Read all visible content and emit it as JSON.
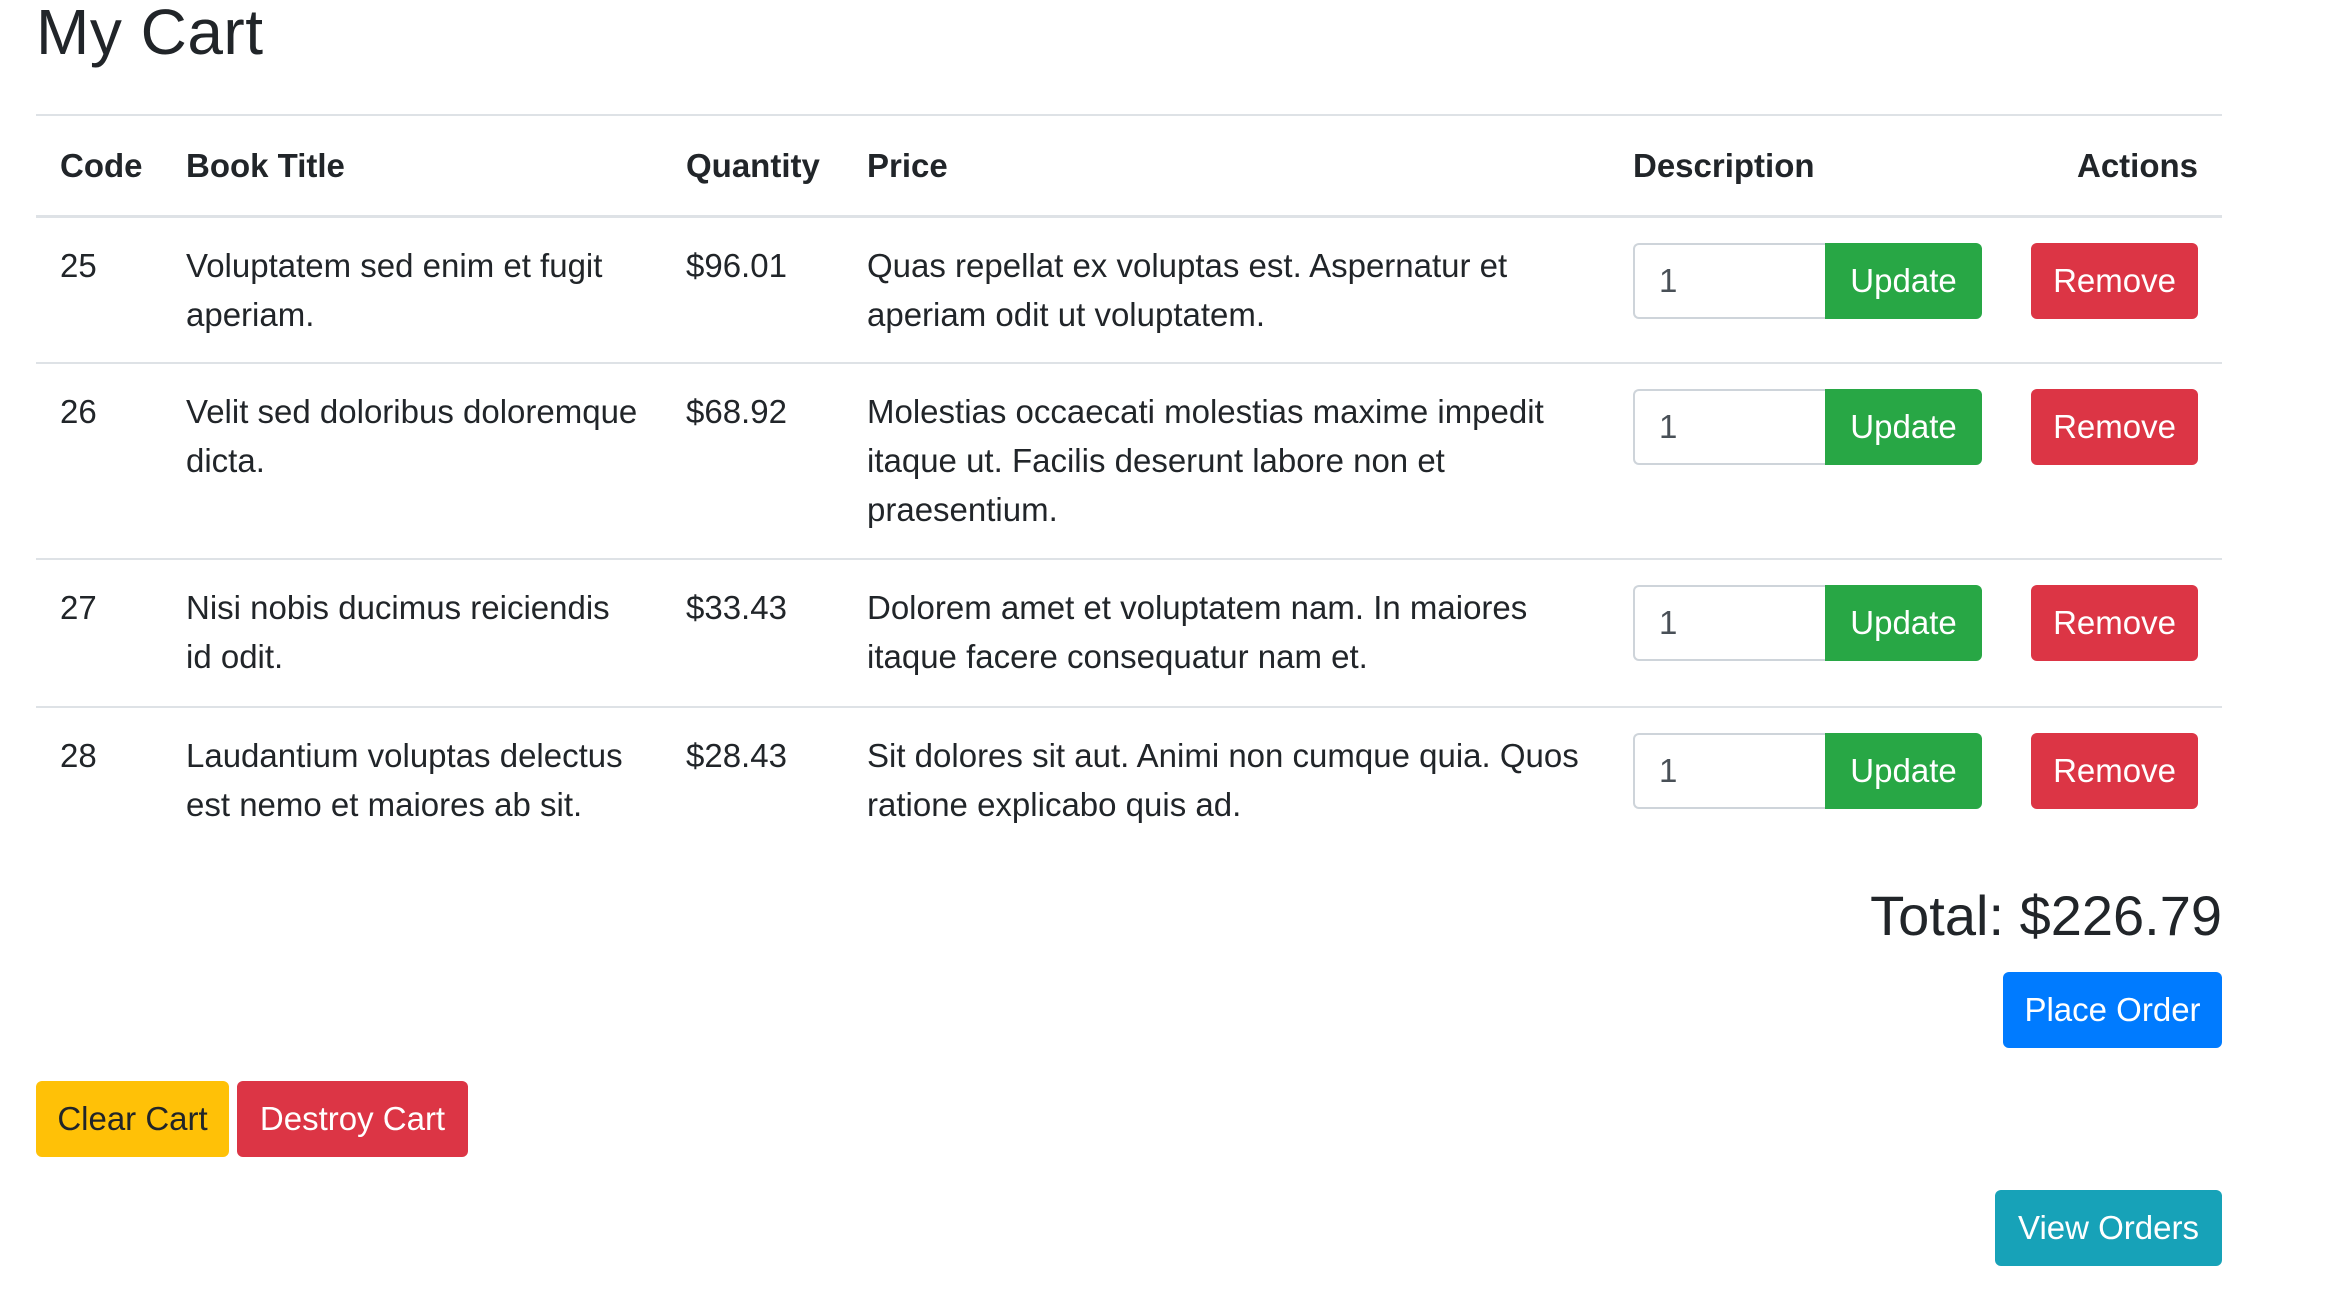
{
  "page": {
    "title": "My Cart"
  },
  "table": {
    "headers": [
      "Code",
      "Book Title",
      "Quantity",
      "Price",
      "Description",
      "Actions"
    ],
    "rows": [
      {
        "code": "25",
        "book_title": "Voluptatem sed enim et fugit aperiam.",
        "quantity": "$96.01",
        "price": "Quas repellat ex voluptas est. Aspernatur et aperiam odit ut voluptatem.",
        "qty_value": "1",
        "update_label": "Update",
        "remove_label": "Remove"
      },
      {
        "code": "26",
        "book_title": "Velit sed doloribus doloremque dicta.",
        "quantity": "$68.92",
        "price": "Molestias occaecati molestias maxime impedit itaque ut. Facilis deserunt labore non et praesentium.",
        "qty_value": "1",
        "update_label": "Update",
        "remove_label": "Remove"
      },
      {
        "code": "27",
        "book_title": "Nisi nobis ducimus reiciendis id odit.",
        "quantity": "$33.43",
        "price": "Dolorem amet et voluptatem nam. In maiores itaque facere consequatur nam et.",
        "qty_value": "1",
        "update_label": "Update",
        "remove_label": "Remove"
      },
      {
        "code": "28",
        "book_title": "Laudantium voluptas delectus est nemo et maiores ab sit.",
        "quantity": "$28.43",
        "price": "Sit dolores sit aut. Animi non cumque quia. Quos ratione explicabo quis ad.",
        "qty_value": "1",
        "update_label": "Update",
        "remove_label": "Remove"
      }
    ]
  },
  "summary": {
    "total_text": "Total: $226.79",
    "place_order_label": "Place Order"
  },
  "footer": {
    "clear_cart_label": "Clear Cart",
    "destroy_cart_label": "Destroy Cart",
    "view_orders_label": "View Orders"
  },
  "colors": {
    "update": "#28a745",
    "remove": "#dc3545",
    "primary": "#007bff",
    "warning": "#ffc107",
    "info": "#17a2b8",
    "border": "#dee2e6"
  }
}
